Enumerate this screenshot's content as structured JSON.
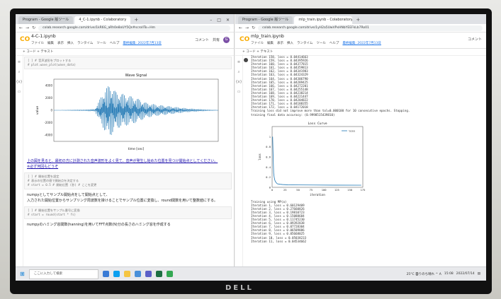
{
  "left": {
    "tabs": [
      "Program - Google 版ツール",
      "4_C-1.ipynb - Colaboratory"
    ],
    "url": "colab.research.google.com/drive/1kR6G_aRh0e8xUY5Qs#scrollTo=Hm",
    "notebook_name": "4-C-1.ipynb",
    "menus": [
      "ファイル",
      "編集",
      "表示",
      "挿入",
      "ランタイム",
      "ツール",
      "ヘルプ"
    ],
    "edited": "最終編集: 2022年7月13日",
    "comment": "コメント",
    "share": "共有",
    "avatar": "G",
    "toolbar": "+ コード  + テキスト",
    "cell1": [
      "[ ] # 音声波形をプロットする",
      "    # plot.wave_plot(wave_data)"
    ],
    "plot_title": "Wave Signal",
    "plot_xlabel": "time [sec]",
    "plot_ylabel": "value",
    "plot_yticks": [
      "4000",
      "2000",
      "0",
      "-2000",
      "-4000"
    ],
    "para1": "上の図を見ると、最初の方に計測された音声波形をよく見て、音声が発生し始めた位置を見つけ開始点としてください。",
    "para1_link": "※必ず何回もどうぞ",
    "cell2": [
      "[ ] # 開始位置を設定",
      "    # 表示の位置の値で開始点を決定する",
      "    # start = 0.5 # 開始位置 (秒) # ここを変更"
    ],
    "para2": "numpyとしてサンプル開始点をして開始点として、",
    "para3": "入力された開始位置からサンプリング周波数を掛けることでサンプル位置に変換し、round関数を用いて整数値にする。",
    "cell3": [
      "[ ] # 開始位置をサンプル番号に変換",
      "    # start = round(start * fs)"
    ],
    "para4": "numpyのハミング窓関数(hanning)を用いてFFT点数(N)分の長さのハミング窓を作成する",
    "para4b": "を作成する"
  },
  "right": {
    "tabs": [
      "Program - Google 版ツール",
      "mlp_train.ipynb - Colaboratory"
    ],
    "url": "colab.research.google.com/drive/1yH2a5UwVPxHNbYEEFkLb7Ro01",
    "notebook_name": "mlp_train.ipynb",
    "menus": [
      "ファイル",
      "編集",
      "表示",
      "挿入",
      "ランタイム",
      "ツール",
      "ヘルプ"
    ],
    "edited": "最終編集: 2022年7月13日",
    "comment": "コメント",
    "toolbar": "+ コード  + テキスト",
    "log_top": [
      "Iteration 158, loss = 0.04414663",
      "Iteration 159, loss = 0.04395926",
      "Iteration 160, loss = 0.04377815",
      "Iteration 161, loss = 0.04359813",
      "Iteration 162, loss = 0.04341983",
      "Iteration 163, loss = 0.04324329",
      "Iteration 164, loss = 0.04306790",
      "Iteration 165, loss = 0.04289425",
      "Iteration 166, loss = 0.04272201",
      "Iteration 167, loss = 0.04255148",
      "Iteration 168, loss = 0.04238214",
      "Iteration 169, loss = 0.04221447",
      "Iteration 170, loss = 0.04204822",
      "Iteration 171, loss = 0.04188355",
      "Iteration 172, loss = 0.04172018",
      "Training loss did not improve more than tol=0.000100 for 10 consecutive epochs. Stopping.",
      "training final data accuracy: (0.9998515439810)"
    ],
    "log_bottom": [
      "Training using MP(a)",
      "Iteration 1, loss = 0.60129409",
      "Iteration 2, loss = 0.27660826",
      "Iteration 3, loss = 0.19810723",
      "Iteration 4, loss = 0.15088684",
      "Iteration 5, loss = 0.11745230",
      "Iteration 6, loss = 0.09392838",
      "Iteration 7, loss = 0.07728304",
      "Iteration 8, loss = 0.06509886",
      "Iteration 9, loss = 0.05668025",
      "Iteration 10, loss = 0.05038233",
      "Iteration 11, loss = 0.04534662"
    ]
  },
  "taskbar": {
    "search_placeholder": "ここに入力して検索",
    "tray_text": "25°C 曇りのち晴れ  ^  A",
    "time": "15:08",
    "date": "2022/07/14"
  },
  "monitor_brand": "DELL",
  "chart_data": [
    {
      "type": "line",
      "title": "Wave Signal",
      "xlabel": "time [sec]",
      "ylabel": "value",
      "ylim": [
        -5000,
        5000
      ],
      "xlim": [
        0,
        1.6
      ],
      "description_series": [
        {
          "name": "signal",
          "x": [
            0.0,
            0.1,
            0.2,
            0.3,
            0.4,
            0.5,
            0.55,
            0.6,
            0.7,
            0.8,
            0.9,
            1.0,
            1.1,
            1.2,
            1.3,
            1.4,
            1.5,
            1.6
          ],
          "y": [
            0,
            50,
            80,
            100,
            200,
            3500,
            4200,
            3000,
            2500,
            2000,
            1200,
            900,
            700,
            500,
            300,
            200,
            100,
            50
          ]
        }
      ]
    },
    {
      "type": "line",
      "title": "Loss Curve",
      "xlabel": "iteration",
      "ylabel": "loss",
      "ylim": [
        0,
        1.2
      ],
      "xlim": [
        0,
        175
      ],
      "series": [
        {
          "name": "loss",
          "x": [
            1,
            2,
            3,
            4,
            5,
            6,
            8,
            10,
            15,
            20,
            30,
            50,
            80,
            120,
            172
          ],
          "y": [
            1.0,
            0.6,
            0.28,
            0.2,
            0.15,
            0.12,
            0.09,
            0.07,
            0.06,
            0.055,
            0.05,
            0.047,
            0.045,
            0.043,
            0.042
          ]
        }
      ]
    }
  ]
}
